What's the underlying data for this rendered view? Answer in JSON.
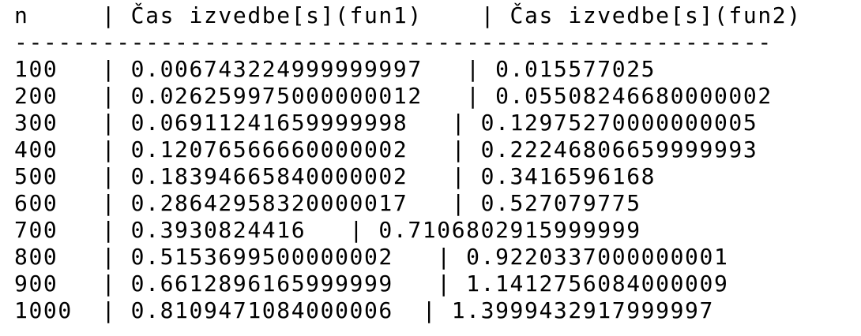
{
  "header": "n     | Čas izvedbe[s](fun1)    | Čas izvedbe[s](fun2)",
  "separator": "----------------------------------------------------",
  "rows": [
    "100   | 0.006743224999999997   | 0.015577025",
    "200   | 0.026259975000000012   | 0.05508246680000002",
    "300   | 0.06911241659999998   | 0.12975270000000005",
    "400   | 0.12076566660000002   | 0.22246806659999993",
    "500   | 0.18394665840000002   | 0.3416596168",
    "600   | 0.28642958320000017   | 0.527079775",
    "700   | 0.3930824416   | 0.7106802915999999",
    "800   | 0.5153699500000002   | 0.9220337000000001",
    "900   | 0.6612896165999999   | 1.1412756084000009",
    "1000  | 0.8109471084000006  | 1.3999432917999997"
  ]
}
